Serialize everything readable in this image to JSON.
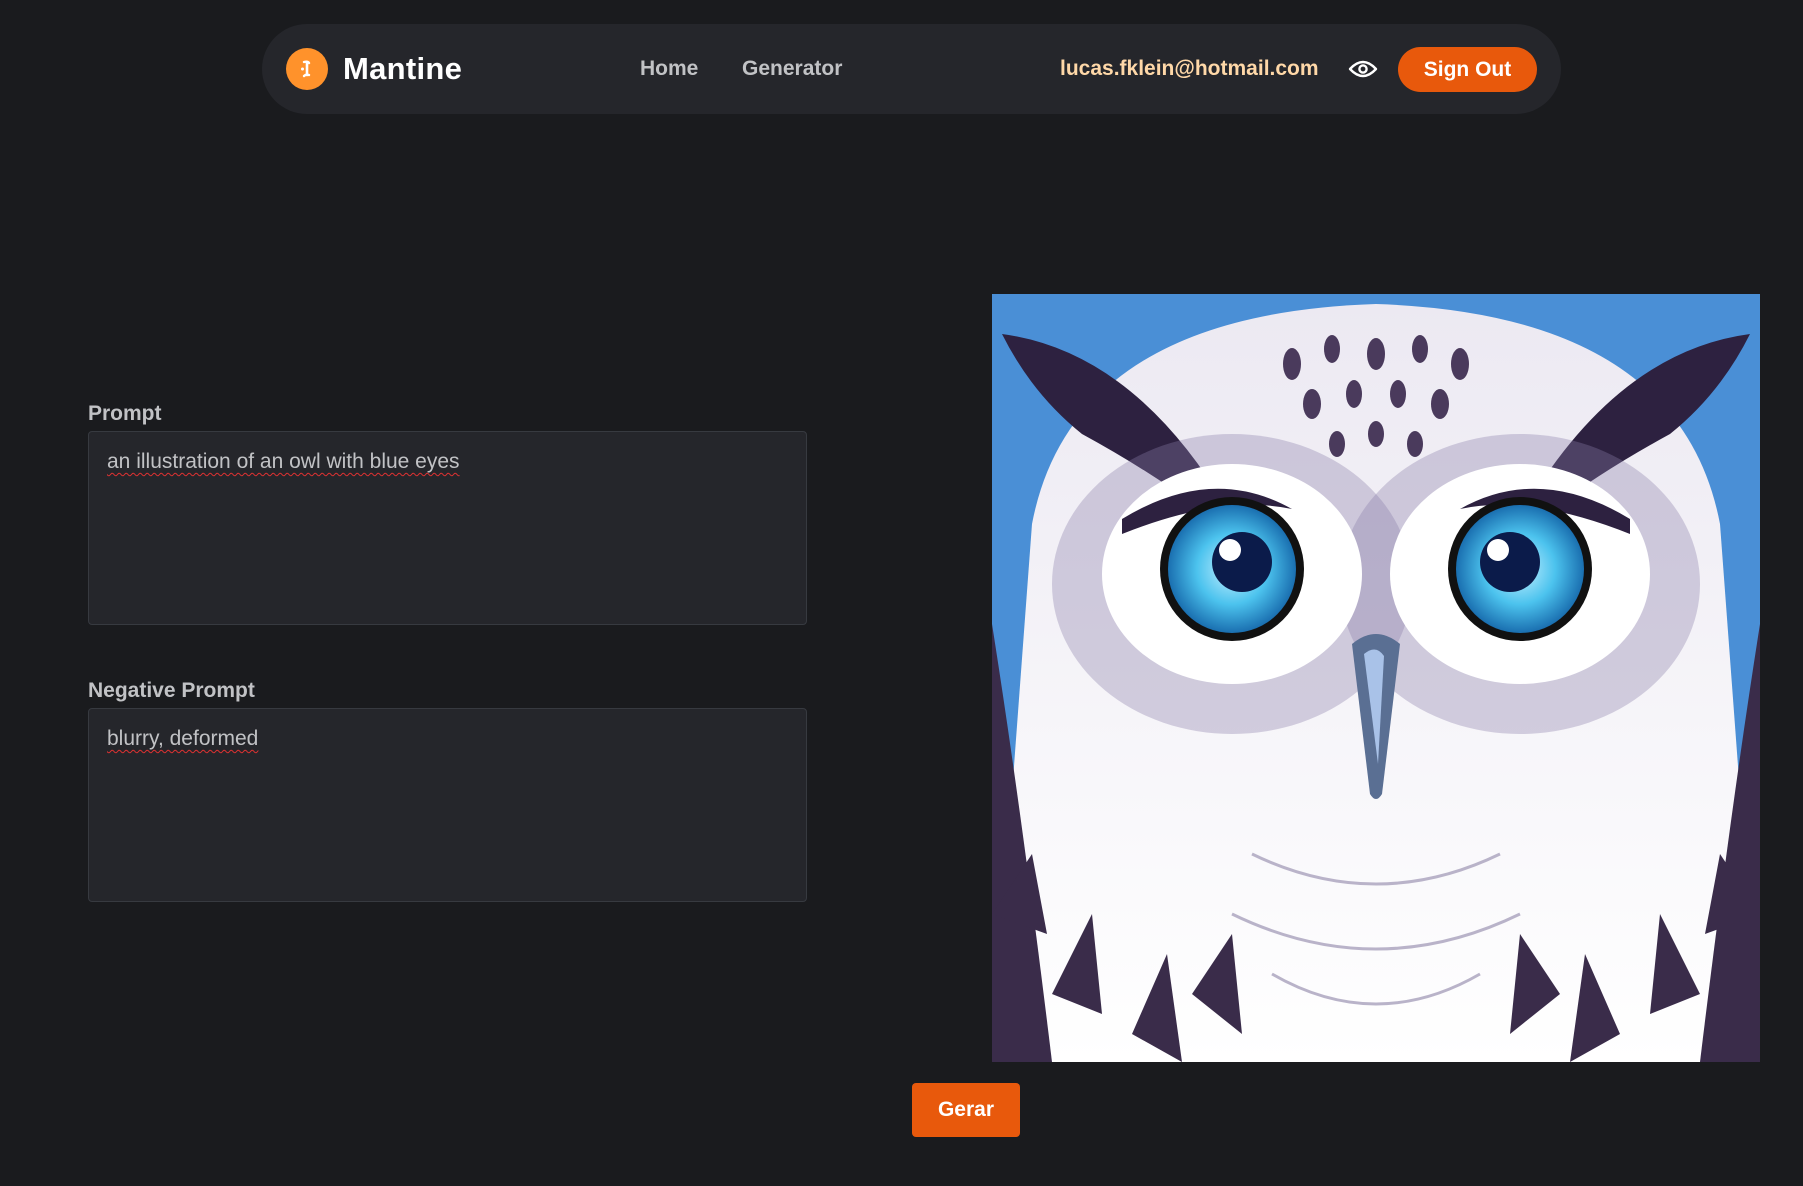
{
  "header": {
    "brand": "Mantine",
    "nav": [
      {
        "label": "Home"
      },
      {
        "label": "Generator"
      }
    ],
    "user_email": "lucas.fklein@hotmail.com",
    "sign_out_label": "Sign Out"
  },
  "form": {
    "prompt_label": "Prompt",
    "prompt_value": "an illustration of an owl with blue eyes",
    "negative_label": "Negative Prompt",
    "negative_value": "blurry, deformed"
  },
  "result": {
    "image_subject": "owl-illustration"
  },
  "actions": {
    "generate_label": "Gerar"
  },
  "colors": {
    "background": "#1a1b1e",
    "surface": "#25262b",
    "accent": "#e8590c",
    "logo": "#ff922b",
    "email": "#ffd8a8"
  },
  "icons": {
    "logo": "mantine-logo-icon",
    "theme_toggle": "eye-icon"
  }
}
